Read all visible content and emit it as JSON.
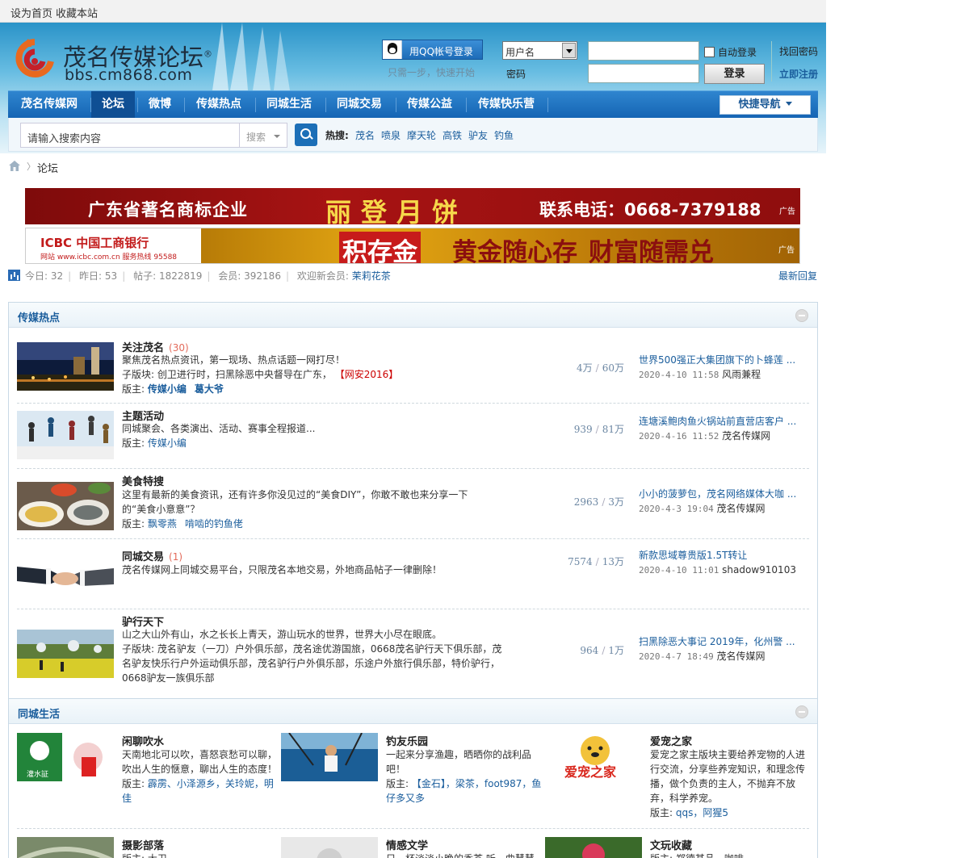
{
  "topbar": {
    "set_home": "设为首页",
    "bookmark": "收藏本站"
  },
  "header": {
    "logo_title": "茂名传媒论坛",
    "logo_reg": "®",
    "logo_url": "bbs.cm868.com",
    "qq_login": "用QQ帐号登录",
    "qq_tip": "只需一步，快速开始",
    "username_select": "用户名",
    "password_label": "密码",
    "autologin": "自动登录",
    "login_button": "登录",
    "find_password": "找回密码",
    "register": "立即注册"
  },
  "nav": {
    "items": [
      "茂名传媒网",
      "论坛",
      "微博",
      "传媒热点",
      "同城生活",
      "同城交易",
      "传媒公益",
      "传媒快乐营"
    ],
    "active": "论坛",
    "quick_nav": "快捷导航"
  },
  "search": {
    "placeholder": "请输入搜索内容",
    "type": "搜索",
    "hot_label": "热搜:",
    "hot_words": [
      "茂名",
      "喷泉",
      "摩天轮",
      "高铁",
      "驴友",
      "钓鱼"
    ]
  },
  "breadcrumb": {
    "current": "论坛",
    "sep": "〉"
  },
  "ads": {
    "ad1_left": "广东省著名商标企业",
    "ad1_mid": "丽登月饼",
    "ad1_right": "联系电话：0668-7379188",
    "ad_tag": "广告",
    "ad2_bank": "ICBC 中国工商银行",
    "ad2_bank_sub": "网站 www.icbc.com.cn  服务热线 95588",
    "ad2_s1": "积存金",
    "ad2_s2": "黄金随心存",
    "ad2_s3": "财富随需兑",
    "ad2_tag": "广告"
  },
  "stats": {
    "today_label": "今日:",
    "today": "32",
    "yesterday_label": "昨日:",
    "yesterday": "53",
    "posts_label": "帖子:",
    "posts": "1822819",
    "members_label": "会员:",
    "members": "392186",
    "welcome_label": "欢迎新会员:",
    "new_member": "茉莉花茶",
    "latest_reply": "最新回复"
  },
  "hot_section": {
    "title": "传媒热点",
    "forums": [
      {
        "name": "关注茂名",
        "new_count": "(30)",
        "desc": "聚焦茂名热点资讯，第一现场、热点话题一网打尽！",
        "sub_label": "子版块:",
        "subs": "创卫进行时，扫黑除恶中央督导在广东，",
        "sub_red": "【网安2016】",
        "mod_label": "版主:",
        "mods": [
          "传媒小编",
          "葛大爷"
        ],
        "threads": "4万",
        "posts": "60万",
        "last_title": "世界500强正大集团旗下的卜蜂莲 ...",
        "last_time": "2020-4-10 11:58",
        "last_user": "风雨兼程"
      },
      {
        "name": "主题活动",
        "new_count": "",
        "desc": "同城聚会、各类演出、活动、赛事全程报道...",
        "mod_label": "版主:",
        "mods": [
          "传媒小编"
        ],
        "threads": "939",
        "posts": "81万",
        "last_title": "连塘溪鲍肉鱼火锅站前直营店客户 ...",
        "last_time": "2020-4-16 11:52",
        "last_user": "茂名传媒网"
      },
      {
        "name": "美食特搜",
        "new_count": "",
        "desc": "这里有最新的美食资讯，还有许多你没见过的“美食DIY”，你敢不敢也来分享一下的“美食小意意”？",
        "mod_label": "版主:",
        "mods": [
          "飘零燕",
          "啃啮的钓鱼佬"
        ],
        "threads": "2963",
        "posts": "3万",
        "last_title": "小小的菠萝包，茂名网络媒体大咖 ...",
        "last_time": "2020-4-3 19:04",
        "last_user": "茂名传媒网"
      },
      {
        "name": "同城交易",
        "new_count": "(1)",
        "desc": "茂名传媒网上同城交易平台，只限茂名本地交易，外地商品帖子一律删除！",
        "threads": "7574",
        "posts": "13万",
        "last_title": "新款思域尊贵版1.5T转让",
        "last_time": "2020-4-10 11:01",
        "last_user": "shadow910103"
      },
      {
        "name": "驴行天下",
        "new_count": "",
        "desc": "山之大山外有山，水之长长上青天，游山玩水的世界，世界大小尽在眼底。",
        "sub_label": "子版块:",
        "subs": "茂名驴友（一刀）户外俱乐部，茂名途优游国旅，0668茂名驴行天下俱乐部，茂名驴友快乐行户外运动俱乐部，茂名驴行户外俱乐部，乐途户外旅行俱乐部，特价驴行，0668驴友一族俱乐部",
        "threads": "964",
        "posts": "1万",
        "last_title": "扫黑除恶大事记 2019年，化州警 ...",
        "last_time": "2020-4-7 18:49",
        "last_user": "茂名传媒网"
      }
    ]
  },
  "life_section": {
    "title": "同城生活",
    "items": [
      {
        "name": "闲聊吹水",
        "desc": "天南地北可以吹，喜怒哀愁可以聊，吹出人生的惬意，聊出人生的态度！",
        "mod_label": "版主:",
        "mods": "霹雳、小泽源乡，关玲妮，明佳"
      },
      {
        "name": "钓友乐园",
        "desc": "一起来分享渔趣，晒晒你的战利品吧！",
        "mod_label": "版主:",
        "mods": "【金石】，梁茶，foot987，鱼仔多又多"
      },
      {
        "name": "爱宠之家",
        "desc": "爱宠之家主版块主要给养宠物的人进行交流，分享些养宠知识，和理念传播，做个负责的主人，不抛弃不放弃，科学养宠。",
        "mod_label": "版主:",
        "mods": "qqs，阿猩5"
      },
      {
        "name": "摄影部落",
        "desc": "版主: 大卫",
        "mod_label": "",
        "mods": ""
      },
      {
        "name": "情感文学",
        "desc": "只一杯淡淡小晚的香茶 听一曲慧慧",
        "mod_label": "",
        "mods": ""
      },
      {
        "name": "文玩收藏",
        "desc": "版主: 郑德其品，咖啡",
        "mod_label": "",
        "mods": ""
      }
    ],
    "aichong_logo_text": "爱宠之家",
    "guanshui_logo_text": "灌水証"
  }
}
